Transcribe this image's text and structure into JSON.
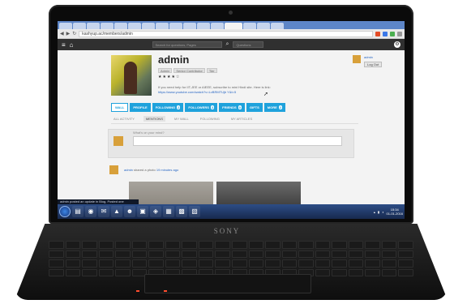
{
  "browser": {
    "url": "kashyup.ac/members/admin",
    "tab_count": 16
  },
  "site": {
    "search_placeholder": "Search for questions, Pages",
    "search_scope": "Questions"
  },
  "profile": {
    "name": "admin",
    "role_chips": [
      "Admin",
      "Senior Contributor",
      "Tier"
    ],
    "stars": "★★★★☆",
    "about": "If you need help for IIT-JEE or AIEEE, subscribe to mini Hindi site. Here is link:",
    "link": "https://www.youtube.com/watch?v=LvBRMTUjb Y&t=5",
    "user_link": "admin",
    "logout_label": "Log Out"
  },
  "profile_tabs": [
    {
      "label": "WALL",
      "count": ""
    },
    {
      "label": "PROFILE",
      "count": ""
    },
    {
      "label": "FOLLOWING",
      "count": "2"
    },
    {
      "label": "FOLLOWERS",
      "count": "3"
    },
    {
      "label": "FRIENDS",
      "count": "0"
    },
    {
      "label": "GIFTS",
      "count": ""
    },
    {
      "label": "MORE",
      "count": "2"
    }
  ],
  "sub_tabs": [
    "ALL ACTIVITY",
    "MENTIONS",
    "MY WALL",
    "FOLLOWING",
    "MY ARTICLES"
  ],
  "post_placeholder": "What's on your mind?",
  "activity": {
    "user": "admin",
    "text": "shared a photo",
    "time": "19 minutes ago"
  },
  "taskbar": {
    "popup": "admin posted an update in Blog, Posted one",
    "time": "15:34",
    "date": "01-01-2016"
  },
  "laptop_brand": "SONY"
}
